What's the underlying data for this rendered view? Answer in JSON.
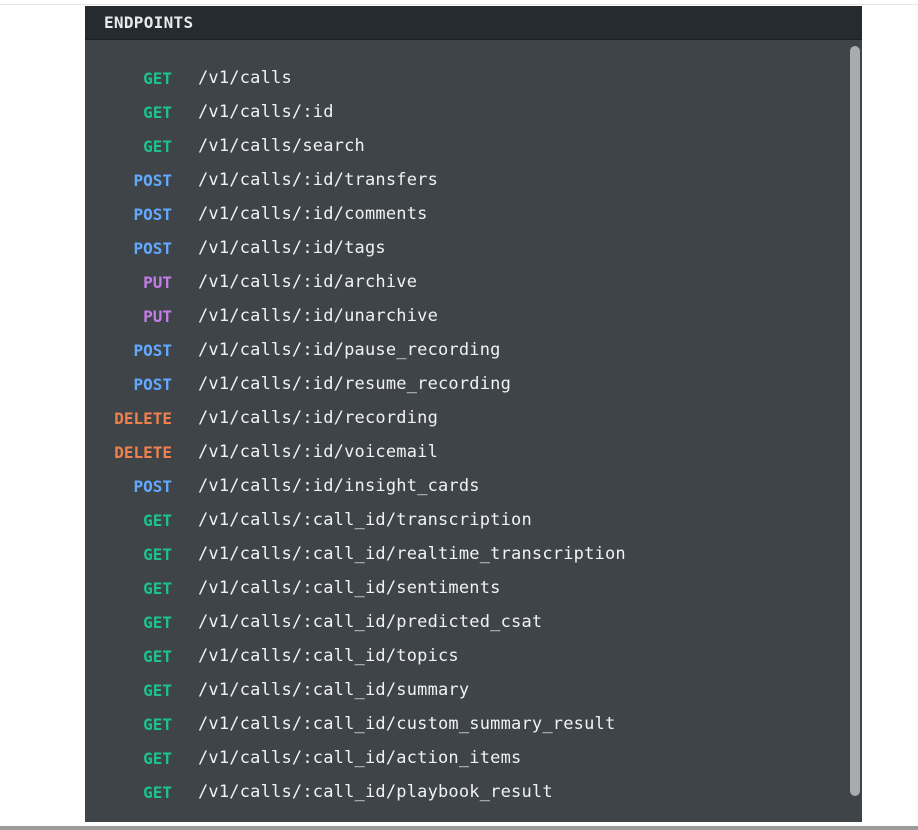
{
  "panel": {
    "title": "ENDPOINTS"
  },
  "method_colors": {
    "GET": "#1ec28b",
    "POST": "#63a9ff",
    "PUT": "#c27ee6",
    "DELETE": "#f0804d"
  },
  "endpoints": [
    {
      "method": "GET",
      "path": "/v1/calls"
    },
    {
      "method": "GET",
      "path": "/v1/calls/:id"
    },
    {
      "method": "GET",
      "path": "/v1/calls/search"
    },
    {
      "method": "POST",
      "path": "/v1/calls/:id/transfers"
    },
    {
      "method": "POST",
      "path": "/v1/calls/:id/comments"
    },
    {
      "method": "POST",
      "path": "/v1/calls/:id/tags"
    },
    {
      "method": "PUT",
      "path": "/v1/calls/:id/archive"
    },
    {
      "method": "PUT",
      "path": "/v1/calls/:id/unarchive"
    },
    {
      "method": "POST",
      "path": "/v1/calls/:id/pause_recording"
    },
    {
      "method": "POST",
      "path": "/v1/calls/:id/resume_recording"
    },
    {
      "method": "DELETE",
      "path": "/v1/calls/:id/recording"
    },
    {
      "method": "DELETE",
      "path": "/v1/calls/:id/voicemail"
    },
    {
      "method": "POST",
      "path": "/v1/calls/:id/insight_cards"
    },
    {
      "method": "GET",
      "path": "/v1/calls/:call_id/transcription"
    },
    {
      "method": "GET",
      "path": "/v1/calls/:call_id/realtime_transcription"
    },
    {
      "method": "GET",
      "path": "/v1/calls/:call_id/sentiments"
    },
    {
      "method": "GET",
      "path": "/v1/calls/:call_id/predicted_csat"
    },
    {
      "method": "GET",
      "path": "/v1/calls/:call_id/topics"
    },
    {
      "method": "GET",
      "path": "/v1/calls/:call_id/summary"
    },
    {
      "method": "GET",
      "path": "/v1/calls/:call_id/custom_summary_result"
    },
    {
      "method": "GET",
      "path": "/v1/calls/:call_id/action_items"
    },
    {
      "method": "GET",
      "path": "/v1/calls/:call_id/playbook_result"
    }
  ]
}
